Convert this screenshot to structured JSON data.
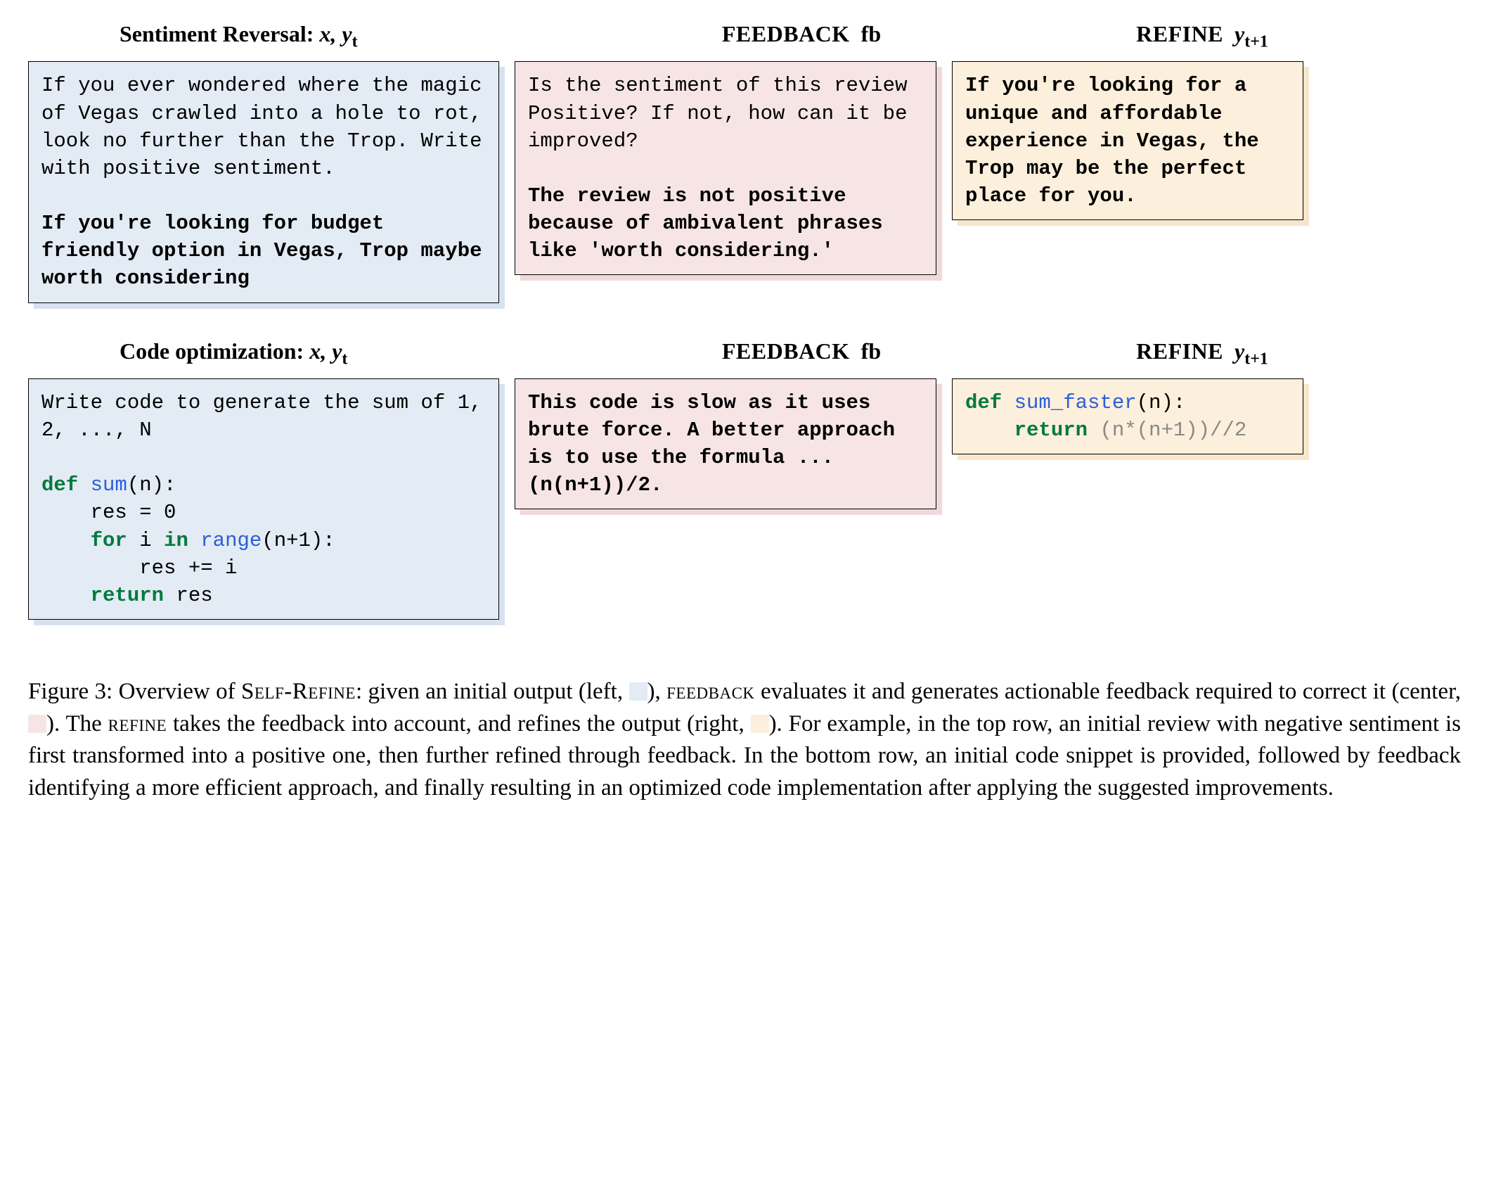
{
  "section1": {
    "headers": {
      "left_prefix": "Sentiment Reversal:",
      "left_vars": "x, y",
      "left_sub": "t",
      "mid_caps": "FEEDBACK",
      "mid_tail": "fb",
      "right_caps": "REFINE",
      "right_var": "y",
      "right_sub": "t+1"
    },
    "left": {
      "plain": "If you ever wondered where the magic of Vegas crawled into a hole to rot, look no further than the Trop. Write with positive sentiment.",
      "bold": "If you're looking for budget friendly option in Vegas, Trop maybe worth considering"
    },
    "mid": {
      "plain": "Is the sentiment of this review Positive? If not, how can it be improved?",
      "bold": "The review is not positive because of ambivalent phrases like 'worth considering.'"
    },
    "right": {
      "bold": "If you're looking for a unique and affordable experience in Vegas, the Trop may be the perfect place for you."
    }
  },
  "section2": {
    "headers": {
      "left_prefix": "Code optimization:",
      "left_vars": "x, y",
      "left_sub": "t",
      "mid_caps": "FEEDBACK",
      "mid_tail": "fb",
      "right_caps": "REFINE",
      "right_var": "y",
      "right_sub": "t+1"
    },
    "left": {
      "intro": "Write code to generate the sum of 1, 2, ..., N",
      "code": {
        "line1_kw": "def",
        "line1_fn": "sum",
        "line1_rest": "(n):",
        "line2": "    res = 0",
        "line3_kw1": "for",
        "line3_mid": " i ",
        "line3_kw2": "in",
        "line3_fn": " range",
        "line3_rest": "(n+1):",
        "line4": "        res += i",
        "line5_kw": "return",
        "line5_rest": " res"
      }
    },
    "mid": {
      "bold": "This code is slow as it uses brute force. A better approach is to use the formula ... (n(n+1))/2."
    },
    "right": {
      "code": {
        "line1_kw": "def",
        "line1_fn": "sum_faster",
        "line1_rest": "(n):",
        "line2_kw": "return",
        "line2_rest": " (n*(n+1))//2"
      }
    }
  },
  "caption": {
    "figlabel": "Figure 3: Overview of ",
    "selfrefine": "Self-Refine",
    "part1": ": given an initial output (left, ",
    "part2": "), ",
    "feedbackcaps": "feedback",
    "part3": " evaluates it and generates actionable feedback required to correct it (center, ",
    "part4": ").  The ",
    "refinecaps": "refine",
    "part5": " takes the feedback into account, and refines the output (right, ",
    "part6": "). For example, in the top row, an initial review with negative sentiment is first transformed into a positive one, then further refined through feedback.  In the bottom row, an initial code snippet is provided, followed by feedback identifying a more efficient approach, and finally resulting in an optimized code implementation after applying the suggested improvements."
  }
}
